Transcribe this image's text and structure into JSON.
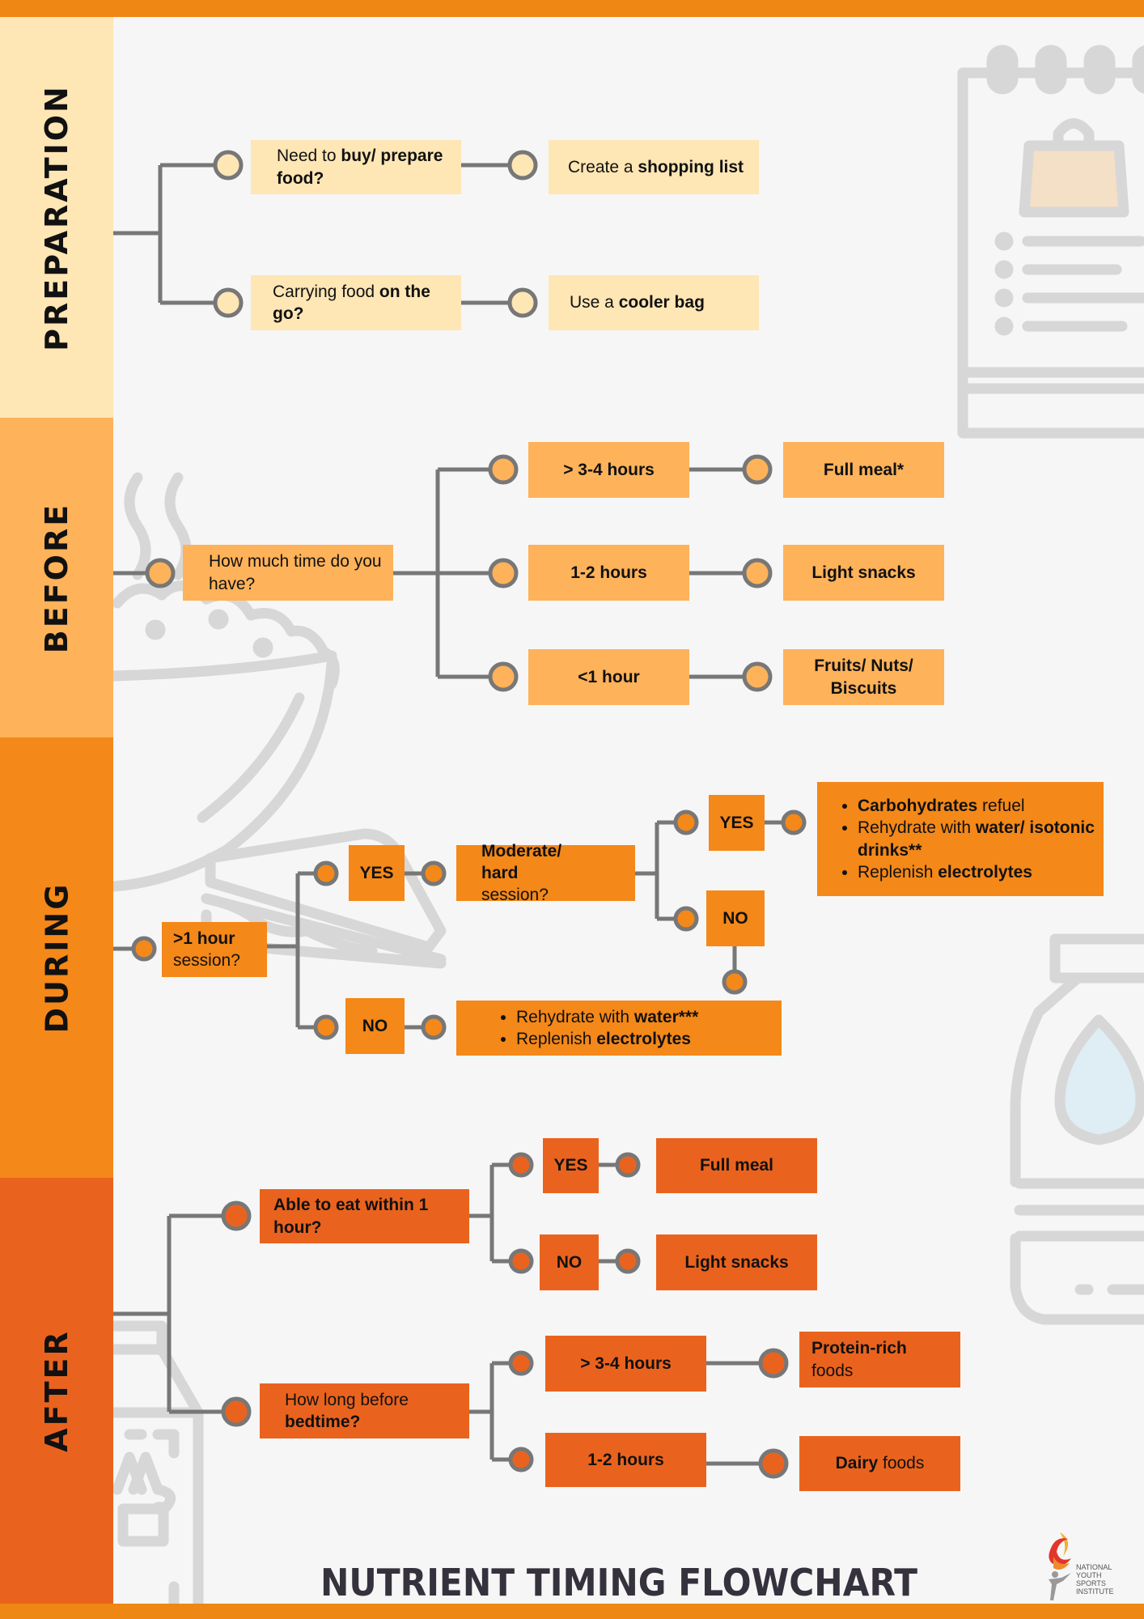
{
  "title": "NUTRIENT TIMING FLOWCHART",
  "logo": {
    "lines": [
      "NATIONAL",
      "YOUTH",
      "SPORTS",
      "INSTITUTE"
    ]
  },
  "colors": {
    "top_bar": "#ef8714",
    "preparation": "#fee6b5",
    "before": "#feb25a",
    "during": "#f48819",
    "after": "#ea631e",
    "connector": "#777777",
    "background": "#f6f6f6",
    "title_text": "#35323d"
  },
  "sections": {
    "preparation": {
      "label": "PREPARATION",
      "rows": [
        {
          "question": [
            {
              "t": "Need to "
            },
            {
              "t": "buy/ prepare food?",
              "b": true
            }
          ],
          "answer": [
            {
              "t": "Create a "
            },
            {
              "t": "shopping list",
              "b": true
            }
          ]
        },
        {
          "question": [
            {
              "t": "Carrying food "
            },
            {
              "t": "on the go?",
              "b": true
            }
          ],
          "answer": [
            {
              "t": "Use a "
            },
            {
              "t": "cooler bag",
              "b": true
            }
          ]
        }
      ]
    },
    "before": {
      "label": "BEFORE",
      "question": "How much time do you have?",
      "options": [
        {
          "time": "> 3-4 hours",
          "result": "Full meal*"
        },
        {
          "time": "1-2 hours",
          "result": "Light snacks"
        },
        {
          "time": "<1 hour",
          "result": "Fruits/ Nuts/ Biscuits"
        }
      ]
    },
    "during": {
      "label": "DURING",
      "question": [
        {
          "t": ">1 hour",
          "b": true
        },
        {
          "t": " session?"
        }
      ],
      "yes_label": "YES",
      "no_label": "NO",
      "sub_question": [
        {
          "t": "Moderate/ hard",
          "b": true
        },
        {
          "t": " session?"
        }
      ],
      "sub_yes_label": "YES",
      "sub_no_label": "NO",
      "yes_result": [
        [
          {
            "t": "Carbohydrates",
            "b": true
          },
          {
            "t": " refuel"
          }
        ],
        [
          {
            "t": "Rehydrate with "
          },
          {
            "t": "water/ isotonic drinks**",
            "b": true
          }
        ],
        [
          {
            "t": "Replenish "
          },
          {
            "t": "electrolytes",
            "b": true
          }
        ]
      ],
      "no_result": [
        [
          {
            "t": "Rehydrate with "
          },
          {
            "t": "water***",
            "b": true
          }
        ],
        [
          {
            "t": "Replenish "
          },
          {
            "t": "electrolytes",
            "b": true
          }
        ]
      ]
    },
    "after": {
      "label": "AFTER",
      "q1": "Able to eat within 1 hour?",
      "q1_yes": "YES",
      "q1_yes_result": "Full meal",
      "q1_no": "NO",
      "q1_no_result": "Light snacks",
      "q2": [
        {
          "t": "How long before "
        },
        {
          "t": "bedtime?",
          "b": true
        }
      ],
      "q2_options": [
        {
          "time": "> 3-4 hours",
          "result": [
            {
              "t": "Protein-rich",
              "b": true
            },
            {
              "t": " foods"
            }
          ]
        },
        {
          "time": "1-2 hours",
          "result": [
            {
              "t": "Dairy",
              "b": true
            },
            {
              "t": " foods"
            }
          ]
        }
      ]
    }
  }
}
